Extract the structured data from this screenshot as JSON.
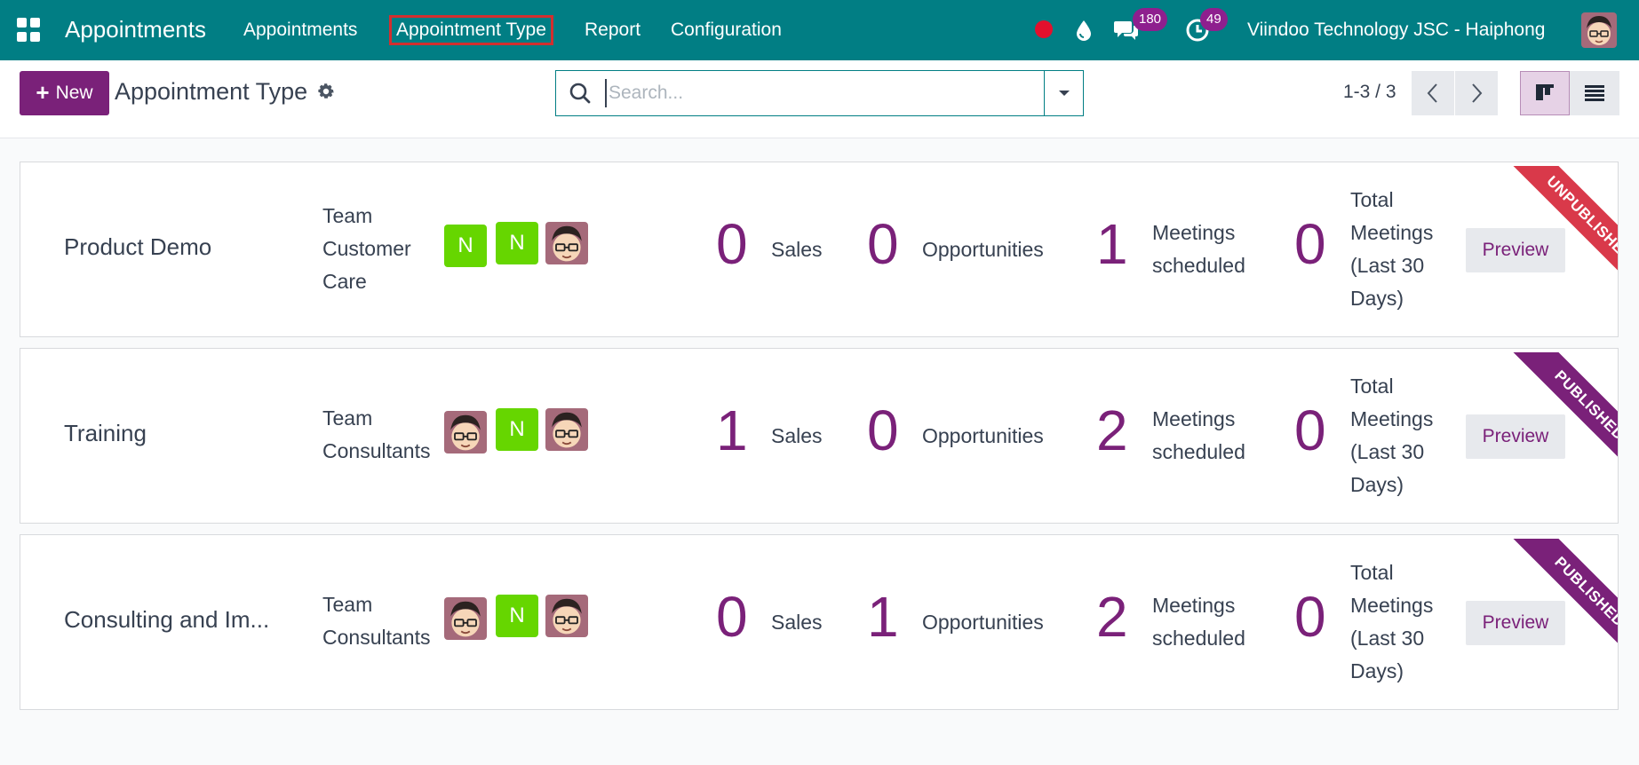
{
  "navbar": {
    "app_name": "Appointments",
    "menu": [
      "Appointments",
      "Appointment Type",
      "Report",
      "Configuration"
    ],
    "messages_count": "180",
    "activities_count": "49",
    "company": "Viindoo Technology JSC - Haiphong"
  },
  "control_panel": {
    "new_label": "New",
    "title": "Appointment Type",
    "search_placeholder": "Search...",
    "pager": "1-3 / 3"
  },
  "colors": {
    "navbar": "#017e84",
    "primary": "#7a2179",
    "unpublished_ribbon": "#d9394a",
    "avatar_letter": "#66d600"
  },
  "cards": [
    {
      "name": "Product Demo",
      "team": [
        "Team",
        "Customer",
        "Care"
      ],
      "staff": [
        "N",
        "N",
        "avatar"
      ],
      "sales": "0",
      "sales_label": "Sales",
      "opportunities": "0",
      "opportunities_label": "Opportunities",
      "meetings": "1",
      "meetings_label": [
        "Meetings",
        "scheduled"
      ],
      "total": "0",
      "total_label": [
        "Total",
        "Meetings",
        "(Last 30",
        "Days)"
      ],
      "preview_label": "Preview",
      "ribbon": "UNPUBLISHED"
    },
    {
      "name": "Training",
      "team": [
        "Team",
        "Consultants"
      ],
      "staff": [
        "avatar",
        "N",
        "avatar"
      ],
      "sales": "1",
      "sales_label": "Sales",
      "opportunities": "0",
      "opportunities_label": "Opportunities",
      "meetings": "2",
      "meetings_label": [
        "Meetings",
        "scheduled"
      ],
      "total": "0",
      "total_label": [
        "Total",
        "Meetings",
        "(Last 30",
        "Days)"
      ],
      "preview_label": "Preview",
      "ribbon": "PUBLISHED"
    },
    {
      "name": "Consulting and Im...",
      "team": [
        "Team",
        "Consultants"
      ],
      "staff": [
        "avatar",
        "N",
        "avatar"
      ],
      "sales": "0",
      "sales_label": "Sales",
      "opportunities": "1",
      "opportunities_label": "Opportunities",
      "meetings": "2",
      "meetings_label": [
        "Meetings",
        "scheduled"
      ],
      "total": "0",
      "total_label": [
        "Total",
        "Meetings",
        "(Last 30",
        "Days)"
      ],
      "preview_label": "Preview",
      "ribbon": "PUBLISHED"
    }
  ]
}
